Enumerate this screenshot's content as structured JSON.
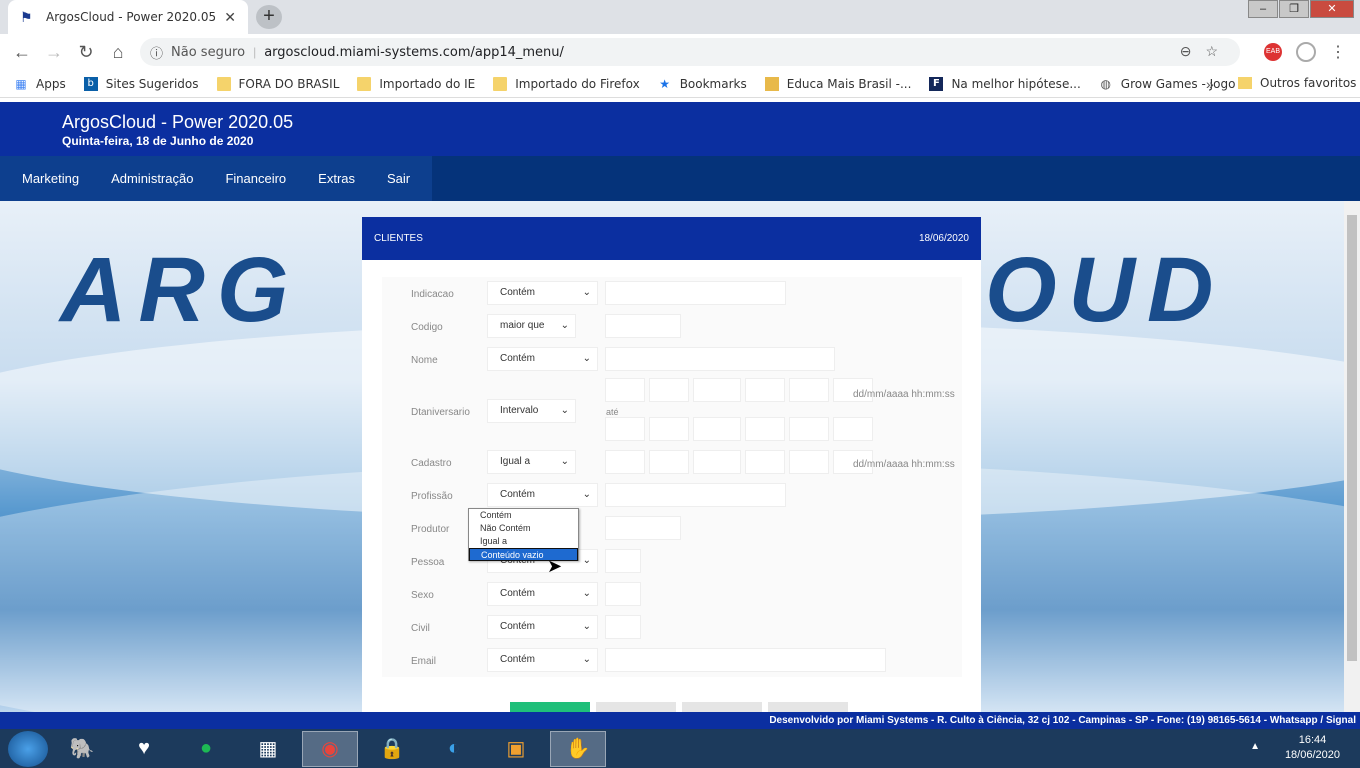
{
  "browser": {
    "tab_title": "ArgosCloud - Power 2020.05",
    "insecure_label": "Não seguro",
    "url": "argoscloud.miami-systems.com/app14_menu/",
    "bookmarks": [
      {
        "label": "Apps"
      },
      {
        "label": "Sites Sugeridos"
      },
      {
        "label": "FORA DO BRASIL"
      },
      {
        "label": "Importado do IE"
      },
      {
        "label": "Importado do Firefox"
      },
      {
        "label": "Bookmarks"
      },
      {
        "label": "Educa Mais Brasil -..."
      },
      {
        "label": "Na melhor hipótese..."
      },
      {
        "label": "Grow Games - Jogo"
      }
    ],
    "other_bookmarks": "Outros favoritos"
  },
  "app": {
    "title": "ArgosCloud - Power 2020.05",
    "date": "Quinta-feira, 18 de Junho de 2020",
    "menu": [
      "Marketing",
      "Administração",
      "Financeiro",
      "Extras",
      "Sair"
    ]
  },
  "panel": {
    "title": "CLIENTES",
    "date": "18/06/2020",
    "fields": {
      "indicacao": {
        "label": "Indicacao",
        "op": "Contém"
      },
      "codigo": {
        "label": "Codigo",
        "op": "maior que"
      },
      "nome": {
        "label": "Nome",
        "op": "Contém"
      },
      "dtaniversario": {
        "label": "Dtaniversario",
        "op": "Intervalo",
        "hint": "dd/mm/aaaa hh:mm:ss",
        "ate": "até"
      },
      "cadastro": {
        "label": "Cadastro",
        "op": "Igual a",
        "hint": "dd/mm/aaaa hh:mm:ss"
      },
      "profissao": {
        "label": "Profissão",
        "op": "Contém"
      },
      "produtor": {
        "label": "Produtor"
      },
      "pessoa": {
        "label": "Pessoa",
        "op": "Contém"
      },
      "sexo": {
        "label": "Sexo",
        "op": "Contém"
      },
      "civil": {
        "label": "Civil",
        "op": "Contém"
      },
      "email": {
        "label": "Email",
        "op": "Contém"
      }
    },
    "dropdown_options": [
      "Contém",
      "Não Contém",
      "Igual a",
      "Conteúdo vazio"
    ]
  },
  "footer": "Desenvolvido por Miami Systems - R. Culto à Ciência, 32 cj 102 - Campinas - SP - Fone: (19) 98165-5614 - Whatsapp / Signal",
  "taskbar": {
    "time": "16:44",
    "date": "18/06/2020"
  }
}
